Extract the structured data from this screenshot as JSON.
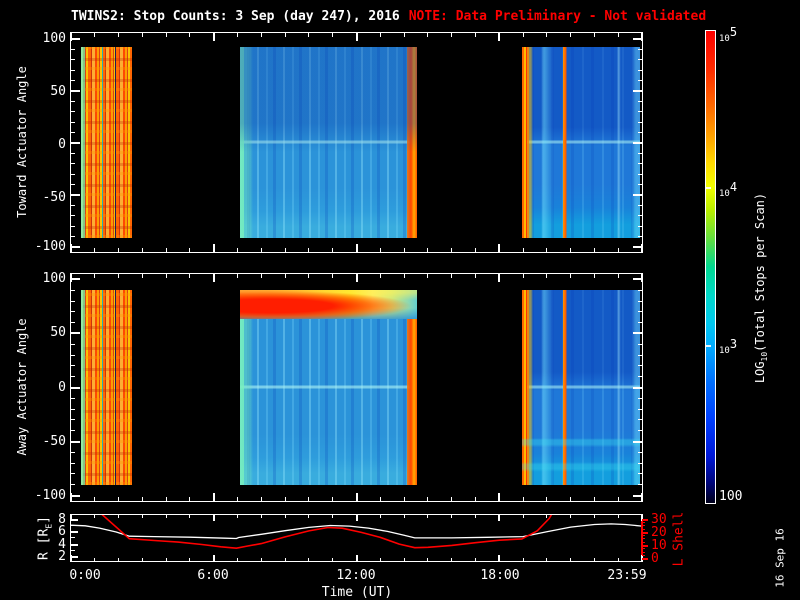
{
  "title": {
    "main": "TWINS2: Stop Counts:  3 Sep (day 247), 2016",
    "note": "NOTE: Data Preliminary - Not validated"
  },
  "colors": {
    "background": "#000000",
    "foreground": "#ffffff",
    "note_red": "#ff0000",
    "r_line": "#ffffff",
    "lshell_line": "#ff0000"
  },
  "panels": {
    "ytick_labels": [
      "100",
      "50",
      "0",
      "-50",
      "-100"
    ],
    "toward": {
      "ylabel": "Toward Actuator Angle"
    },
    "away": {
      "ylabel": "Away Actuator Angle"
    },
    "bottom": {
      "left_label_pre": "R [R",
      "left_label_sub": "E",
      "left_label_post": "]",
      "left_ticks": [
        "8",
        "6",
        "4",
        "2"
      ],
      "right_label": "L Shell",
      "right_ticks": [
        "30",
        "20",
        "10",
        "0"
      ]
    }
  },
  "xaxis": {
    "tick_labels": [
      "0:00",
      "6:00",
      "12:00",
      "18:00",
      "23:59"
    ],
    "label": "Time (UT)"
  },
  "colorbar": {
    "label_pre": "LOG",
    "label_sub": "10",
    "label_post": "(Total Stops per Scan)",
    "tick_bases": [
      "10",
      "10",
      "10",
      "100"
    ],
    "tick_exps": [
      "5",
      "4",
      "3",
      ""
    ]
  },
  "datestamp": "16 Sep 16",
  "chart_data": [
    {
      "type": "heatmap",
      "title": "TWINS2 Stop Counts - Toward Actuator Angle",
      "xlabel": "Time (UT)",
      "ylabel": "Toward Actuator Angle",
      "x_range_hours": [
        0,
        24
      ],
      "y_range": [
        -100,
        100
      ],
      "data_angle_extent": [
        -90,
        90
      ],
      "color_scale": "log10 rainbow, 100 (dark blue/black) to 1e5 (red) total stops per scan",
      "segments": [
        {
          "t_start": "0:25",
          "t_end": "2:30",
          "level": "~1e4-1e5",
          "character": "saturated noisy orange/red/yellow vertical striping with scattered cyan and dark specks, greenish left edge"
        },
        {
          "t_start": "7:07",
          "t_end": "14:30",
          "level": "~1e3",
          "character": "smooth cyan-blue field, darker blue upper half, pale cyan horizontal line at angle 0, green-cyan left edge column, bright cyan columns near right end, noisy orange right edge"
        },
        {
          "t_start": "19:00",
          "t_end": "23:59",
          "level": "~1e3",
          "character": "blue field, noisy orange left edge, bright orange vertical line near 20:45, pale cyan line at angle 0, faint light columns at ~22:00 and right edge, cyan tint at bottom"
        }
      ]
    },
    {
      "type": "heatmap",
      "title": "TWINS2 Stop Counts - Away Actuator Angle",
      "xlabel": "Time (UT)",
      "ylabel": "Away Actuator Angle",
      "x_range_hours": [
        0,
        24
      ],
      "y_range": [
        -100,
        100
      ],
      "data_angle_extent": [
        -90,
        90
      ],
      "color_scale": "log10 rainbow, 100 (dark blue/black) to 1e5 (red) total stops per scan",
      "segments": [
        {
          "t_start": "0:25",
          "t_end": "2:30",
          "level": "~1e4-1e5",
          "character": "saturated noisy orange/red/yellow vertical striping"
        },
        {
          "t_start": "7:07",
          "t_end": "14:30",
          "level": "~1e3 with ~1e4-1e5 band",
          "character": "intense yellow-to-red emission band at angles ~+70 to +90 (red core 7:10-10:45 fading to yellow/green toward 14:00), cyan-blue field below, pale cyan line at angle 0, orange right edge"
        },
        {
          "t_start": "19:00",
          "t_end": "23:59",
          "level": "~1e3",
          "character": "blue field, noisy orange left edge, bright orange vertical line near 20:45, pale cyan line at angle 0, cyan horizontal striping near bottom"
        }
      ]
    },
    {
      "type": "line",
      "x_unit": "hours UT",
      "x_range": [
        0,
        24
      ],
      "series": [
        {
          "name": "R [RE]",
          "color": "#ffffff",
          "axis": "left",
          "ylim": [
            2,
            8
          ],
          "points": [
            [
              0,
              7.05
            ],
            [
              0.6,
              6.95
            ],
            [
              1.2,
              6.6
            ],
            [
              1.9,
              6.0
            ],
            [
              2.45,
              5.35
            ],
            [
              3.5,
              5.3
            ],
            [
              5,
              5.2
            ],
            [
              6.5,
              5.05
            ],
            [
              6.95,
              5.0
            ],
            [
              7.05,
              5.15
            ],
            [
              8,
              5.65
            ],
            [
              9,
              6.2
            ],
            [
              10,
              6.7
            ],
            [
              10.9,
              7.0
            ],
            [
              11.7,
              6.9
            ],
            [
              12.5,
              6.6
            ],
            [
              13.3,
              6.1
            ],
            [
              14,
              5.5
            ],
            [
              14.45,
              5.1
            ],
            [
              16,
              5.1
            ],
            [
              17.5,
              5.18
            ],
            [
              19.0,
              5.3
            ],
            [
              19.15,
              5.4
            ],
            [
              20,
              6.05
            ],
            [
              21,
              6.75
            ],
            [
              22,
              7.15
            ],
            [
              22.7,
              7.25
            ],
            [
              23.3,
              7.15
            ],
            [
              24,
              6.9
            ]
          ]
        },
        {
          "name": "L Shell",
          "color": "#ff0000",
          "axis": "right",
          "ylim": [
            0,
            30
          ],
          "points": [
            [
              1.15,
              36
            ],
            [
              1.3,
              33
            ],
            [
              2.45,
              15.2
            ],
            [
              3.5,
              13.9
            ],
            [
              4.5,
              12.7
            ],
            [
              5.5,
              11.0
            ],
            [
              6.3,
              9.3
            ],
            [
              6.95,
              8.3
            ],
            [
              7.4,
              9.8
            ],
            [
              8,
              11.6
            ],
            [
              9,
              16.5
            ],
            [
              10,
              20.9
            ],
            [
              10.8,
              23.4
            ],
            [
              11.4,
              22.9
            ],
            [
              12.2,
              19.8
            ],
            [
              13,
              16.2
            ],
            [
              13.8,
              11.3
            ],
            [
              14.45,
              8.6
            ],
            [
              15,
              8.9
            ],
            [
              16,
              10.3
            ],
            [
              17,
              12.3
            ],
            [
              18,
              14.1
            ],
            [
              18.95,
              15.1
            ],
            [
              19.6,
              21
            ],
            [
              20.1,
              30
            ],
            [
              20.3,
              36
            ]
          ]
        }
      ]
    },
    {
      "type": "colorbar",
      "label": "LOG10(Total Stops per Scan)",
      "orientation": "vertical",
      "scale": "log",
      "range": [
        100,
        100000
      ],
      "ticks": [
        "1e5",
        "1e4",
        "1e3",
        "100"
      ],
      "colors_top_to_bottom": [
        "#ff0000",
        "#ffa800",
        "#f2ff00",
        "#62de3f",
        "#00d8c8",
        "#00aaff",
        "#0040ff",
        "#000575",
        "#00001a"
      ]
    }
  ]
}
